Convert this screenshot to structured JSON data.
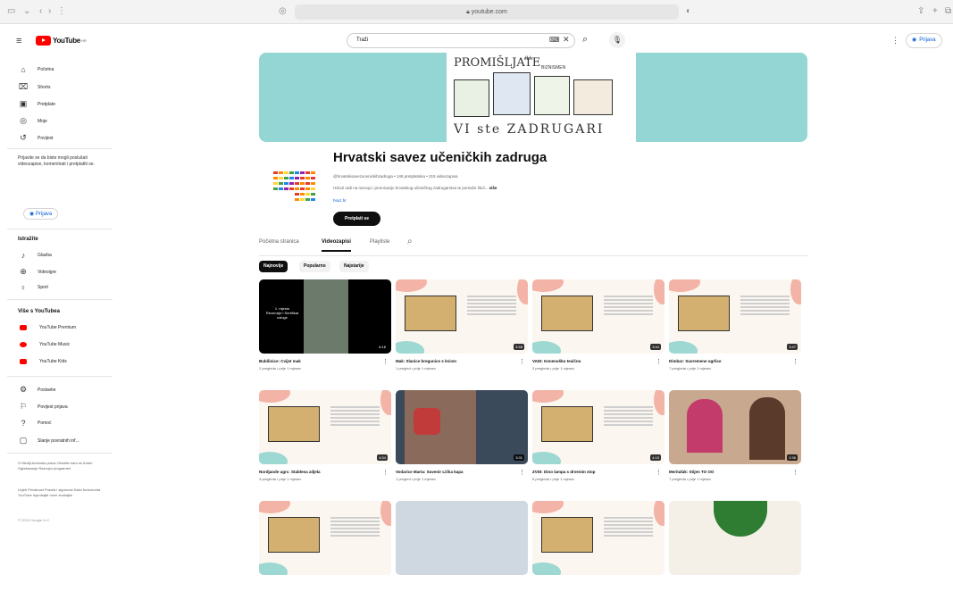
{
  "browser": {
    "url": "youtube.com"
  },
  "header": {
    "logo_text": "YouTube",
    "logo_region": "HR",
    "search_value": "Traži",
    "signin_label": "Prijava"
  },
  "sidebar": {
    "nav": [
      {
        "label": "Početna",
        "icon": "home-icon"
      },
      {
        "label": "Shorts",
        "icon": "shorts-icon"
      },
      {
        "label": "Pretplate",
        "icon": "subscriptions-icon"
      },
      {
        "label": "Moje",
        "icon": "you-icon"
      },
      {
        "label": "Povijest",
        "icon": "history-icon"
      }
    ],
    "signin_prompt": "Prijavite se da biste mogli poslušati videozapise, komentirati i pretplatiti se.",
    "signin_button": "Prijava",
    "explore_heading": "Istražite",
    "explore": [
      {
        "label": "Glazba",
        "icon": "music-icon"
      },
      {
        "label": "Videoigre",
        "icon": "gaming-icon"
      },
      {
        "label": "Sport",
        "icon": "sport-icon"
      }
    ],
    "more_heading": "Više s YouTubea",
    "more": [
      {
        "label": "YouTube Premium",
        "color": "#ff0000"
      },
      {
        "label": "YouTube Music",
        "color": "#ff0000"
      },
      {
        "label": "YouTube Kids",
        "color": "#ff0000"
      }
    ],
    "settings": [
      {
        "label": "Postavke",
        "icon": "gear-icon"
      },
      {
        "label": "Povijest prijava",
        "icon": "flag-icon"
      },
      {
        "label": "Pomoć",
        "icon": "help-icon"
      },
      {
        "label": "Slanje povratnih inf...",
        "icon": "feedback-icon"
      }
    ],
    "footer1": "O Mediji Autorska prava Obratite nam se Autori Oglašavanje Razvojni programeri",
    "footer2": "Uvjeti Privatnost Pravila i sigurnost Kako funkcionira YouTube Isprobajte nove značajke",
    "copyright": "© 2024 Google LLC"
  },
  "banner": {
    "art_title": "PROMIŠLJATE",
    "art_subtitle": "ILI",
    "art_text2": "BIZNISMEN",
    "art_bottom": "VI ste ZADRUGARI"
  },
  "channel": {
    "name": "Hrvatski savez učeničkih zadruga",
    "meta": "@hrvatskisavezucenickihzadruga • 148 pretplatnika • 215 videozapisa",
    "desc": "HSUZ radi na razvoju i promicanju hrvatskog učeničkog zadrugarstva te pomaže škol...",
    "desc_more": "više",
    "link": "hsuz.hr",
    "subscribe": "Pretplati se"
  },
  "tabs": [
    "Početna stranica",
    "Videozapisi",
    "Playliste"
  ],
  "chips": [
    "Najnovije",
    "Popularno",
    "Najstarije"
  ],
  "videos": [
    {
      "title": "Bubilinice: Cvijet mak",
      "meta": "2 pregleda • prije 1 mjesec",
      "dur": "6:16",
      "style": "dark"
    },
    {
      "title": "Mak: Slanice bregunice s lećom",
      "meta": "1 pregled • prije 1 mjesec",
      "dur": "4:58",
      "style": "light"
    },
    {
      "title": "VADI: Kenenoško tesično",
      "meta": "3 pregleda • prije 1 mjesec",
      "dur": "3:44",
      "style": "light"
    },
    {
      "title": "Dimbar: Suvremene ogrlice",
      "meta": "7 pregleda • prije 1 mjesec",
      "dur": "3:47",
      "style": "light"
    },
    {
      "title": "Nordjaode ugrc: Stablena zdjela",
      "meta": "3 pregleda • prije 1 mjesec",
      "dur": "4:54",
      "style": "light"
    },
    {
      "title": "Vodarice Marta: Suvenir Lička kapa",
      "meta": "1 pregled • prije 1 mjesec",
      "dur": "3:31",
      "style": "photo"
    },
    {
      "title": "ZVDI: Dino lampa s drvenim stop",
      "meta": "5 pregleda • prije 1 mjesec",
      "dur": "4:15",
      "style": "light"
    },
    {
      "title": "Meritafak: Stijen TO OO",
      "meta": "7 pregleda • prije 1 mjesec",
      "dur": "2:36",
      "style": "photo2"
    },
    {
      "title": "",
      "meta": "",
      "dur": "",
      "style": "light"
    },
    {
      "title": "",
      "meta": "",
      "dur": "",
      "style": "photo3"
    },
    {
      "title": "",
      "meta": "",
      "dur": "",
      "style": "light"
    },
    {
      "title": "",
      "meta": "",
      "dur": "",
      "style": "photo4"
    }
  ],
  "video1_overlay": "1. mjesto\nRecenzije i Sertifikat usluge"
}
